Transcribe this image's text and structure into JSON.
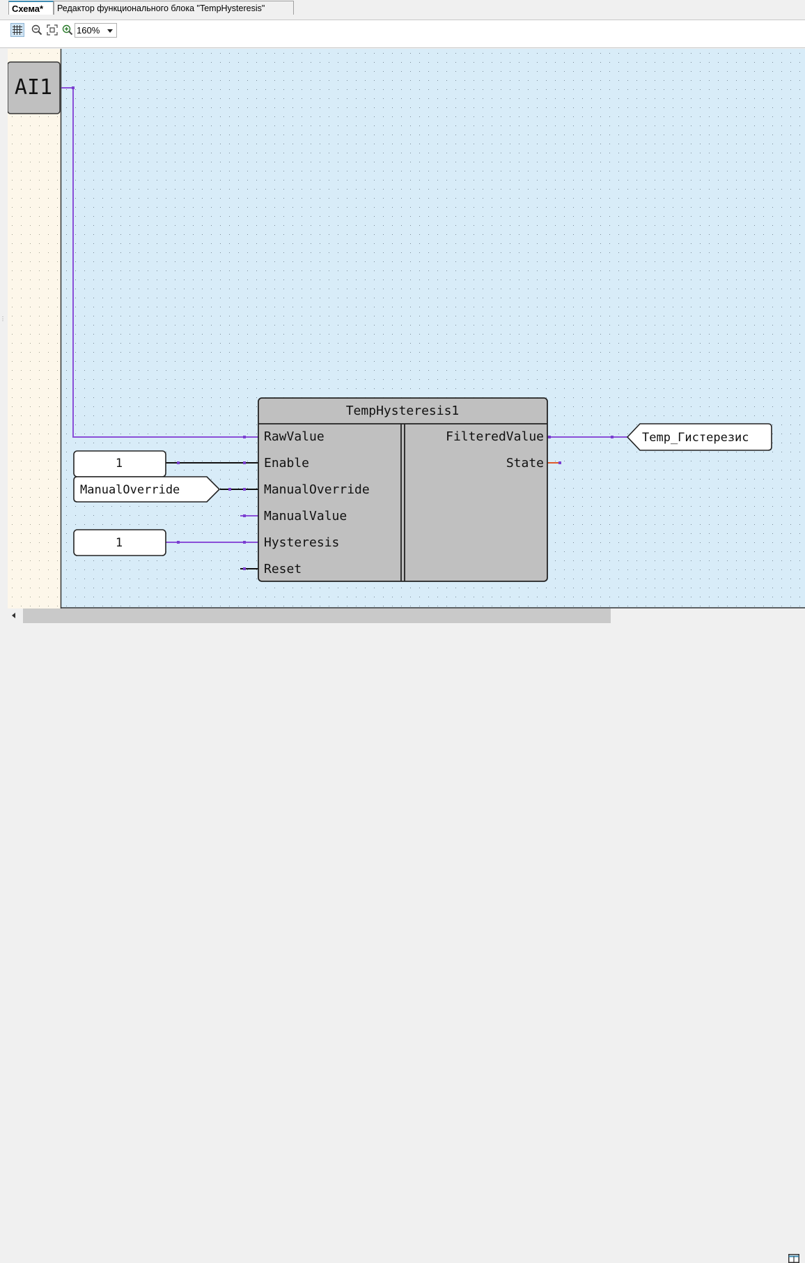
{
  "tabs": [
    {
      "label": "Схема*",
      "active": true
    },
    {
      "label": "Редактор функционального блока \"TempHysteresis\"",
      "active": false
    }
  ],
  "toolbar": {
    "zoom_value": "160%",
    "icons": [
      "grid-icon",
      "zoom-out-icon",
      "zoom-fit-icon",
      "zoom-in-icon"
    ]
  },
  "schema": {
    "input_block": "AI1",
    "function_block": {
      "title": "TempHysteresis1",
      "inputs": [
        "RawValue",
        "Enable",
        "ManualOverride",
        "ManualValue",
        "Hysteresis",
        "Reset"
      ],
      "outputs": [
        "FilteredValue",
        "State"
      ]
    },
    "constants": {
      "enable": "1",
      "hysteresis": "1"
    },
    "input_var": "ManualOverride",
    "output_var": "Temp_Гистерезис"
  },
  "colors": {
    "wire_analog": "#8a4fd8",
    "wire_bool": "#111111",
    "wire_state": "#e05a2a",
    "canvas_bg": "#d8ecf8",
    "margin_bg": "#fdf7ea",
    "block_fill": "#c0c0c0"
  }
}
